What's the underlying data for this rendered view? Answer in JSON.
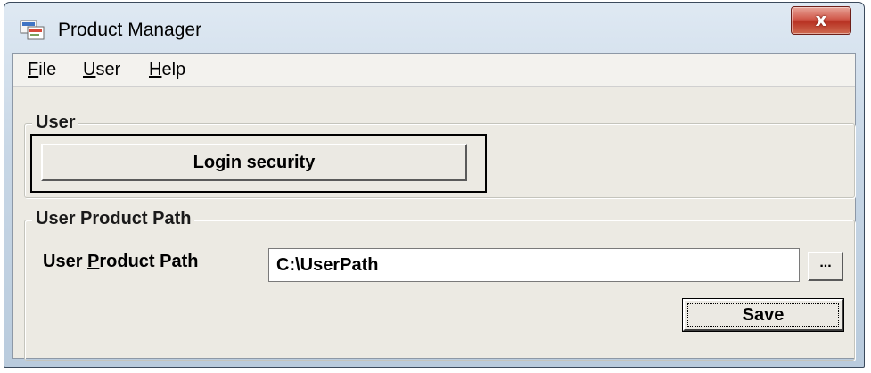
{
  "window": {
    "title": "Product Manager",
    "close_glyph": "x"
  },
  "menu": {
    "items": [
      {
        "label": "File",
        "access": "F",
        "rest": "ile"
      },
      {
        "label": "User",
        "access": "U",
        "rest": "ser"
      },
      {
        "label": "Help",
        "access": "H",
        "rest": "elp"
      }
    ]
  },
  "user_group": {
    "label": "User",
    "login_button_label": "Login security"
  },
  "path_group": {
    "label": "User Product Path",
    "field_label_pre": "User ",
    "field_label_access": "P",
    "field_label_post": "roduct Path",
    "field_value": "C:\\UserPath",
    "browse_label": "...",
    "save_label": "Save"
  },
  "colors": {
    "title_bar": "#c8d7e6",
    "client_background": "#eceae3",
    "close_button": "#c4402f"
  },
  "icons": [
    "app-icon",
    "close-icon",
    "browse-icon"
  ]
}
